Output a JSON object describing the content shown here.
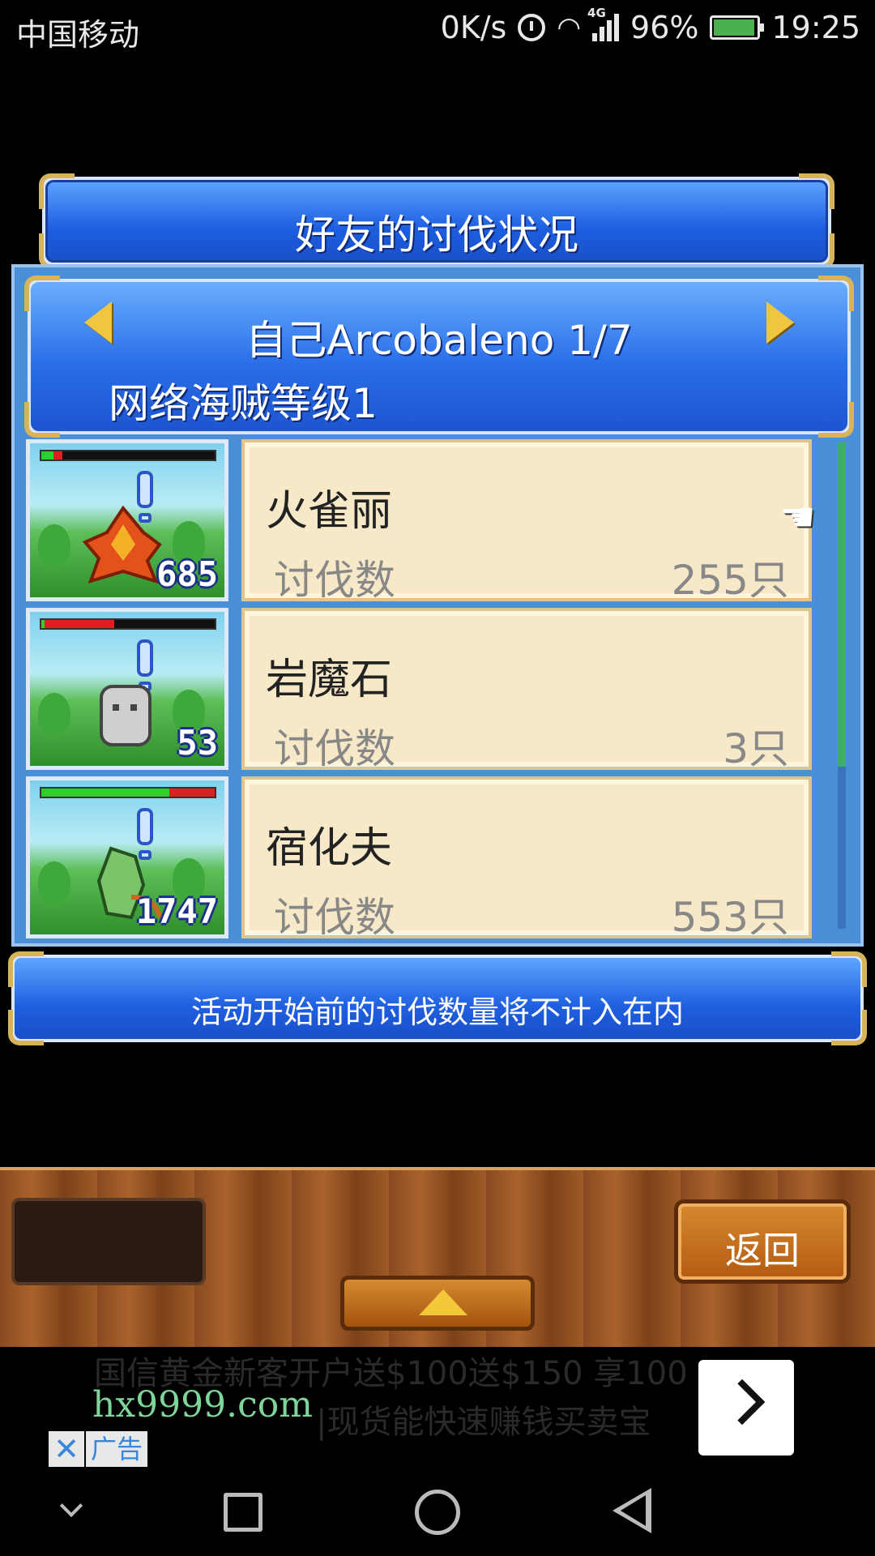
{
  "status_bar": {
    "carrier": "中国移动",
    "speed": "0K/s",
    "battery": "96%",
    "time": "19:25",
    "network": "4G"
  },
  "dialog": {
    "title": "好友的讨伐状况",
    "player_name": "自己Arcobaleno 1/7",
    "level_label": "网络海贼等级1",
    "monsters": [
      {
        "name": "火雀丽",
        "kill_label": "讨伐数",
        "kill_value": "255只",
        "level": "685",
        "hp_red_fraction": 0.12,
        "hp_green_fraction": 0.07
      },
      {
        "name": "岩魔石",
        "kill_label": "讨伐数",
        "kill_value": "3只",
        "level": "53",
        "hp_red_fraction": 0.42,
        "hp_green_fraction": 0.02
      },
      {
        "name": "宿化夫",
        "kill_label": "讨伐数",
        "kill_value": "553只",
        "level": "1747",
        "hp_red_fraction": 1.0,
        "hp_green_fraction": 0.74
      }
    ],
    "notice": "活动开始前的讨伐数量将不计入在内"
  },
  "bottom_bar": {
    "back_label": "返回"
  },
  "ad": {
    "domain": "hx9999.com",
    "tag": "广告",
    "close_symbol": "✕",
    "bg_line1": "国信黄金新客开户送$100送$150 享100",
    "bg_line2": "|现货能快速赚钱买卖宝"
  },
  "icons": {
    "left_arrow": "arrow-left-icon",
    "right_arrow": "arrow-right-icon",
    "pointer": "hand-pointer-icon",
    "up": "triangle-up-icon",
    "ad_next": "chevron-right-icon"
  },
  "colors": {
    "panel_blue": "#1c5ee0",
    "gold": "#f0c640",
    "card_bg": "#f7e9c8",
    "wood": "#a9622c"
  }
}
